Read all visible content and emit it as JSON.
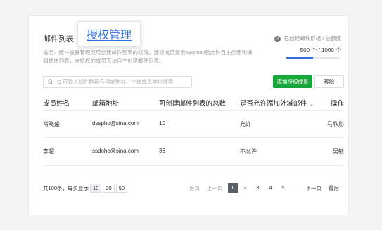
{
  "tabs": {
    "mail_list": "邮件列表",
    "authorized": "授权管理"
  },
  "description": "说明：统一设置管理员可创建邮件列表的权限。授权成员登录webmail后允许自主创建和编辑邮件列表，未授权的成员无法自主创建邮件列表。",
  "quota": {
    "label": "已创建邮件群组 / 总额度",
    "used": 500,
    "total": 1000,
    "unit": "个",
    "text": "500 个 / 1000 个",
    "fill_percent": 50,
    "accent": "#2f6de1"
  },
  "search": {
    "placeholder": "Q 可输入邮件群组名称或地址、个体成员地址搜索"
  },
  "buttons": {
    "add": "添加授权成员",
    "remove": "移除",
    "add_color": "#17a63a"
  },
  "table": {
    "headers": [
      "成员姓名",
      "邮箱地址",
      "可创建邮件列表的总数",
      "是否允许添加外域邮件",
      "操作"
    ],
    "rows": [
      {
        "name": "常晓盛",
        "email": "dsspho@sina.com",
        "count": "10",
        "external": "允许",
        "action": "马欣彤"
      },
      {
        "name": "李超",
        "email": "ssdohe@sina.com",
        "count": "36",
        "external": "不允许",
        "action": "吴敏"
      }
    ]
  },
  "pagination": {
    "total_label": "共100条，每页显示",
    "sizes": [
      "10",
      "20",
      "50"
    ],
    "first": "首页",
    "prev": "上一页",
    "pages": [
      "1",
      "2",
      "3",
      "4",
      "5"
    ],
    "ellipsis": "...",
    "next": "下一页",
    "last": "最后",
    "current": "1"
  }
}
